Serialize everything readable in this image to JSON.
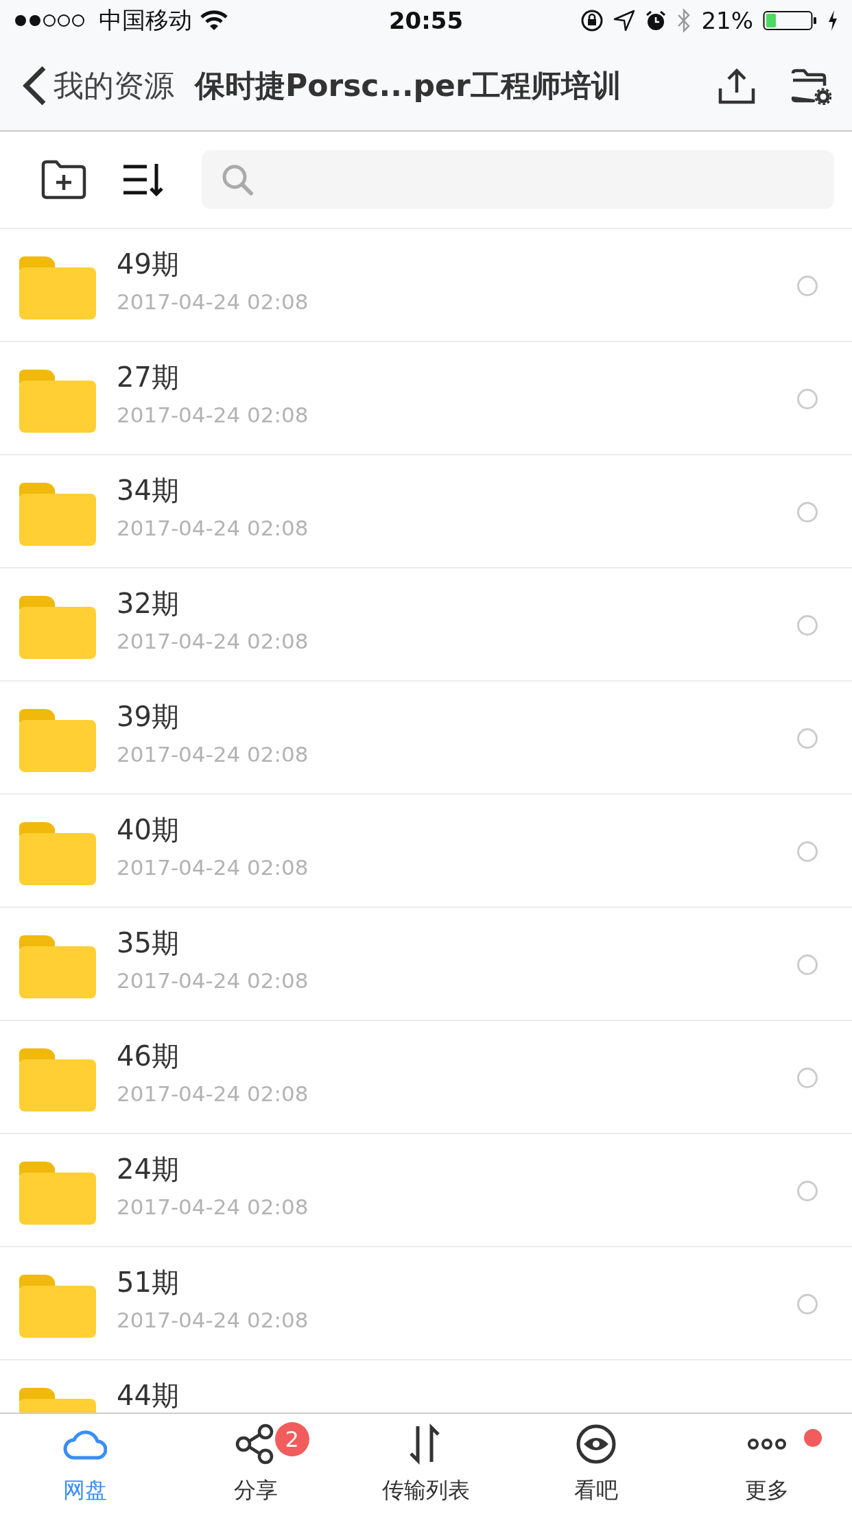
{
  "status_bar": {
    "carrier": "中国移动",
    "time": "20:55",
    "battery": "21%"
  },
  "nav_bar": {
    "back_label": "我的资源",
    "title": "保时捷Porsc...per工程师培训"
  },
  "files": [
    {
      "name": "49期",
      "date": "2017-04-24 02:08",
      "selected": false
    },
    {
      "name": "27期",
      "date": "2017-04-24 02:08",
      "selected": false
    },
    {
      "name": "34期",
      "date": "2017-04-24 02:08",
      "selected": false
    },
    {
      "name": "32期",
      "date": "2017-04-24 02:08",
      "selected": false
    },
    {
      "name": "39期",
      "date": "2017-04-24 02:08",
      "selected": false
    },
    {
      "name": "40期",
      "date": "2017-04-24 02:08",
      "selected": false
    },
    {
      "name": "35期",
      "date": "2017-04-24 02:08",
      "selected": false
    },
    {
      "name": "46期",
      "date": "2017-04-24 02:08",
      "selected": false
    },
    {
      "name": "24期",
      "date": "2017-04-24 02:08",
      "selected": false
    },
    {
      "name": "51期",
      "date": "2017-04-24 02:08",
      "selected": false
    },
    {
      "name": "44期"
    }
  ],
  "tab_bar": [
    {
      "kind": "cloud",
      "label": "网盘",
      "selected": true,
      "dot": false
    },
    {
      "kind": "share",
      "label": "分享",
      "selected": false,
      "badge": "2",
      "dot": false
    },
    {
      "kind": "transfer",
      "label": "传输列表",
      "selected": false,
      "dot": false
    },
    {
      "kind": "eye",
      "label": "看吧",
      "selected": false,
      "dot": false
    },
    {
      "kind": "more",
      "label": "更多",
      "selected": false,
      "dot": true
    }
  ]
}
